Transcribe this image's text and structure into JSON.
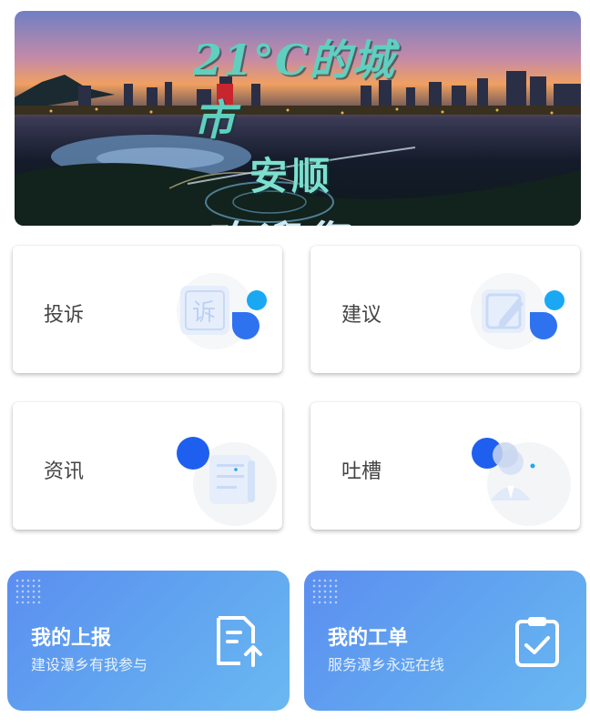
{
  "banner": {
    "line1": "21°C的城市",
    "line2": "安顺",
    "line3": "欢迎您"
  },
  "cards": [
    {
      "label": "投诉",
      "icon": "complaint-icon"
    },
    {
      "label": "建议",
      "icon": "suggestion-icon"
    },
    {
      "label": "资讯",
      "icon": "news-icon"
    },
    {
      "label": "吐槽",
      "icon": "chat-icon"
    }
  ],
  "tiles": [
    {
      "title": "我的上报",
      "subtitle": "建设瀑乡有我参与",
      "icon": "report-upload-icon"
    },
    {
      "title": "我的工单",
      "subtitle": "服务瀑乡永远在线",
      "icon": "clipboard-check-icon"
    }
  ],
  "colors": {
    "accent_blue": "#1e5ff0",
    "accent_cyan": "#1aa8f5",
    "tile_gradient_start": "#5b8ef0",
    "tile_gradient_end": "#6ab8f2"
  }
}
